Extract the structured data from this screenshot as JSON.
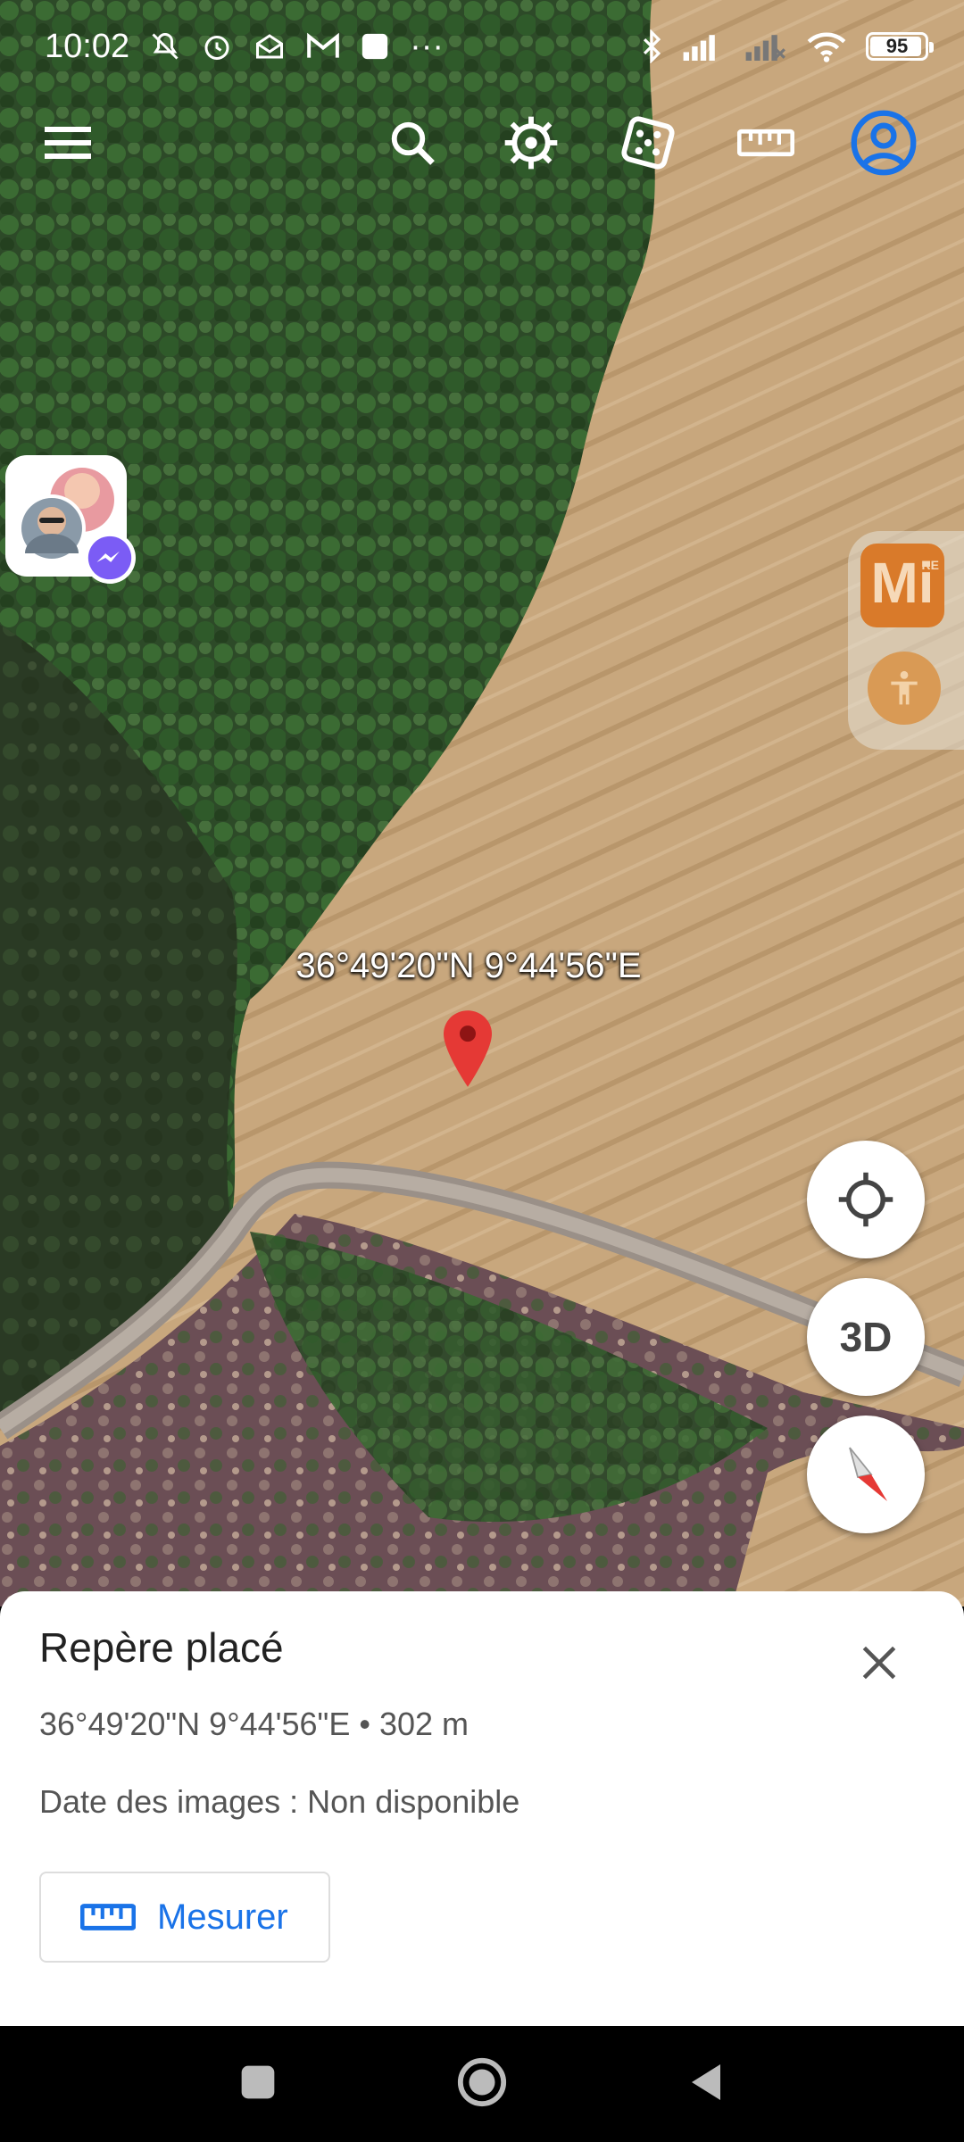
{
  "status_bar": {
    "time": "10:02",
    "battery": "95",
    "battery_level": 0.95,
    "more_indicator": "···"
  },
  "toolbar": {
    "icons": [
      "menu-icon",
      "search-icon",
      "voyager-icon",
      "random-dice-icon",
      "ruler-icon",
      "account-icon"
    ],
    "accent_color": "#1a73e8"
  },
  "map": {
    "pin_label": "36°49'20\"N 9°44'56\"E",
    "pin_color": "#e53935"
  },
  "side_panel": {
    "app_badge": "Mi",
    "app_badge_small": "RE"
  },
  "fabs": {
    "three_d_label": "3D"
  },
  "sheet": {
    "title": "Repère placé",
    "coords": "36°49'20\"N 9°44'56\"E • 302 m",
    "date": "Date des images : Non disponible",
    "measure_label": "Mesurer"
  }
}
